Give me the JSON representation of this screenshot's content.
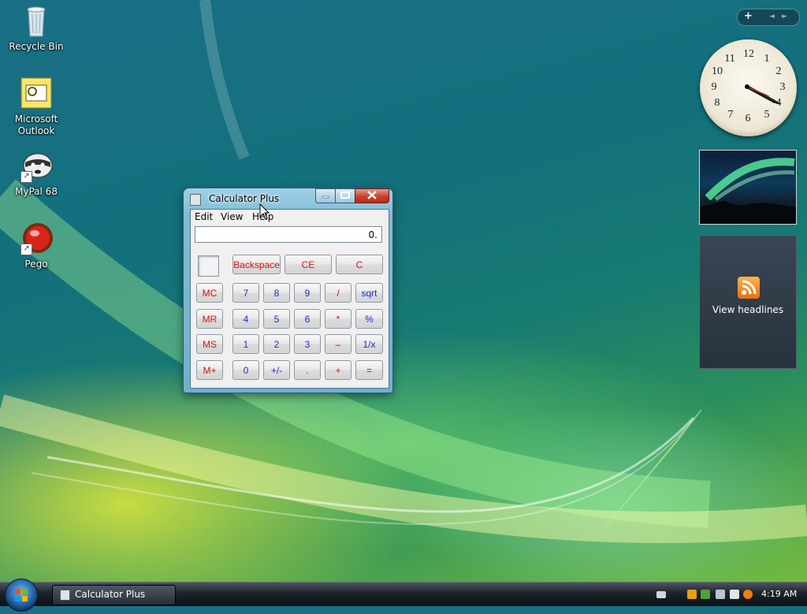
{
  "desktop": {
    "icons": [
      {
        "label": "Recycle Bin",
        "icon": "recycle-bin-icon"
      },
      {
        "label": "Microsoft Outlook",
        "icon": "outlook-icon"
      },
      {
        "label": "MyPal 68",
        "icon": "mypal-raccoon-icon"
      },
      {
        "label": "Pego",
        "icon": "pego-red-ball-icon"
      }
    ]
  },
  "calculator": {
    "title": "Calculator Plus",
    "menu": [
      "Edit",
      "View",
      "Help"
    ],
    "display": "0.",
    "top_keys": [
      "Backspace",
      "CE",
      "C"
    ],
    "memory_keys": [
      "MC",
      "MR",
      "MS",
      "M+"
    ],
    "rows": [
      [
        "7",
        "8",
        "9",
        "/",
        "sqrt"
      ],
      [
        "4",
        "5",
        "6",
        "*",
        "%"
      ],
      [
        "1",
        "2",
        "3",
        "–",
        "1/x"
      ],
      [
        "0",
        "+/-",
        ".",
        "+",
        "="
      ]
    ]
  },
  "gadgets": {
    "bar": {
      "add": "+",
      "prev": "◄",
      "next": "►"
    },
    "clock": {
      "time": "4:19",
      "numerals": [
        "12",
        "1",
        "2",
        "3",
        "4",
        "5",
        "6",
        "7",
        "8",
        "9",
        "10",
        "11"
      ]
    },
    "feeds": {
      "label": "View headlines"
    }
  },
  "taskbar": {
    "task_button": "Calculator Plus",
    "time": "4:19 AM"
  },
  "colors": {
    "red_key_text": "#d41414",
    "blue_key_text": "#1b2fc7",
    "close_button": "#c9412c"
  }
}
